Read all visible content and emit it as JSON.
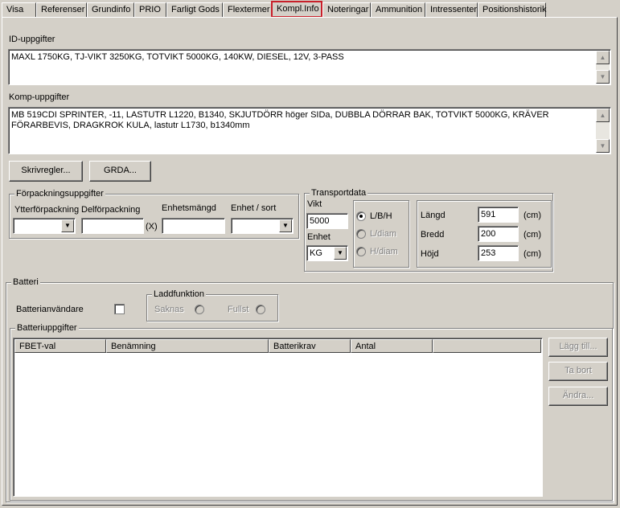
{
  "tabs": [
    "Visa",
    "Referenser",
    "Grundinfo",
    "PRIO",
    "Farligt Gods",
    "Flextermer",
    "Kompl.Info",
    "Noteringar",
    "Ammunition",
    "Intressenter",
    "Positionshistorik"
  ],
  "active_tab": "Kompl.Info",
  "id_section": {
    "label": "ID-uppgifter",
    "value": "MAXL 1750KG, TJ-VIKT 3250KG, TOTVIKT 5000KG, 140KW, DIESEL, 12V, 3-PASS"
  },
  "komp_section": {
    "label": "Komp-uppgifter",
    "value": "MB 519CDI SPRINTER, -11, LASTUTR L1220, B1340, SKJUTDÖRR höger SIDa, DUBBLA DÖRRAR BAK, TOTVIKT 5000KG, KRÄVER FÖRARBEVIS, DRAGKROK KULA, lastutr L1730, b1340mm"
  },
  "buttons": {
    "skrivregler": "Skrivregler...",
    "grda": "GRDA...",
    "lagg_till": "Lägg till...",
    "ta_bort": "Ta bort",
    "andra": "Ändra..."
  },
  "forpackning": {
    "title": "Förpackningsuppgifter",
    "ytter_label": "Ytterförpackning",
    "del_label": "Delförpackning",
    "multiplier": "(X)",
    "enhetsmangd_label": "Enhetsmängd",
    "enhet_sort_label": "Enhet / sort",
    "ytter_value": "",
    "del_value": "",
    "enhetsmangd_value": "",
    "enhet_sort_value": ""
  },
  "transport": {
    "title": "Transportdata",
    "vikt_label": "Vikt",
    "vikt_value": "5000",
    "enhet_label": "Enhet",
    "enhet_value": "KG",
    "radio_lbh": "L/B/H",
    "radio_ldiam": "L/diam",
    "radio_hdiam": "H/diam",
    "selected_radio": "L/B/H",
    "langd_label": "Längd",
    "langd_value": "591",
    "bredd_label": "Bredd",
    "bredd_value": "200",
    "hojd_label": "Höjd",
    "hojd_value": "253",
    "unit": "(cm)"
  },
  "batteri": {
    "title": "Batteri",
    "anvandare_label": "Batterianvändare",
    "anvandare_checked": false,
    "laddfunktion_title": "Laddfunktion",
    "saknas_label": "Saknas",
    "fullst_label": "Fullst"
  },
  "batteriuppgifter": {
    "title": "Batteriuppgifter",
    "columns": [
      "FBET-val",
      "Benämning",
      "Batterikrav",
      "Antal"
    ],
    "rows": []
  },
  "colors": {
    "background": "#d4d0c8",
    "active_tab_border": "#c8202a"
  },
  "icons": [
    "scroll-up-arrow-icon",
    "scroll-down-arrow-icon",
    "dropdown-arrow-icon"
  ]
}
